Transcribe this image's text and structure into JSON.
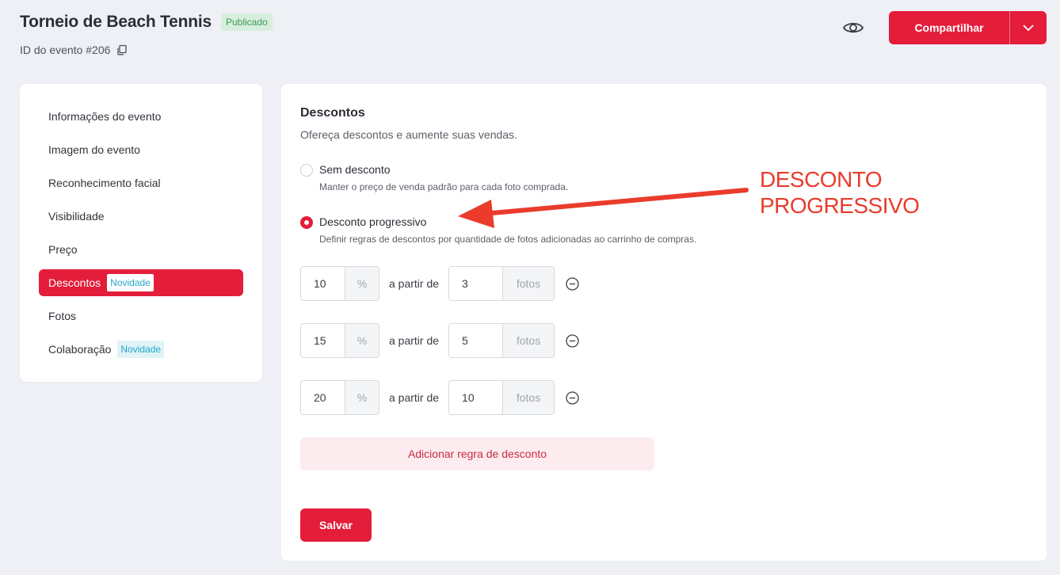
{
  "header": {
    "title": "Torneio de Beach Tennis",
    "status_badge": "Publicado",
    "event_id": "ID do evento #206",
    "share_label": "Compartilhar",
    "accent_color": "#e41d3a"
  },
  "sidebar": {
    "items": [
      {
        "label": "Informações do evento"
      },
      {
        "label": "Imagem do evento"
      },
      {
        "label": "Reconhecimento facial"
      },
      {
        "label": "Visibilidade"
      },
      {
        "label": "Preço"
      },
      {
        "label": "Descontos",
        "tag": "Novidade",
        "active": true
      },
      {
        "label": "Fotos"
      },
      {
        "label": "Colaboração",
        "tag": "Novidade"
      }
    ]
  },
  "main": {
    "title": "Descontos",
    "subtitle": "Ofereça descontos e aumente suas vendas.",
    "options": [
      {
        "label": "Sem desconto",
        "description": "Manter o preço de venda padrão para cada foto comprada.",
        "checked": false
      },
      {
        "label": "Desconto progressivo",
        "description": "Definir regras de descontos por quantidade de fotos adicionadas ao carrinho de compras.",
        "checked": true
      }
    ],
    "rules": [
      {
        "percent": "10",
        "percent_suffix": "%",
        "connector": "a partir de",
        "quantity": "3",
        "quantity_suffix": "fotos"
      },
      {
        "percent": "15",
        "percent_suffix": "%",
        "connector": "a partir de",
        "quantity": "5",
        "quantity_suffix": "fotos"
      },
      {
        "percent": "20",
        "percent_suffix": "%",
        "connector": "a partir de",
        "quantity": "10",
        "quantity_suffix": "fotos"
      }
    ],
    "add_rule_label": "Adicionar regra de desconto",
    "save_label": "Salvar"
  },
  "annotation": {
    "line1": "DESCONTO",
    "line2": "PROGRESSIVO",
    "color": "#ea3b2c"
  }
}
